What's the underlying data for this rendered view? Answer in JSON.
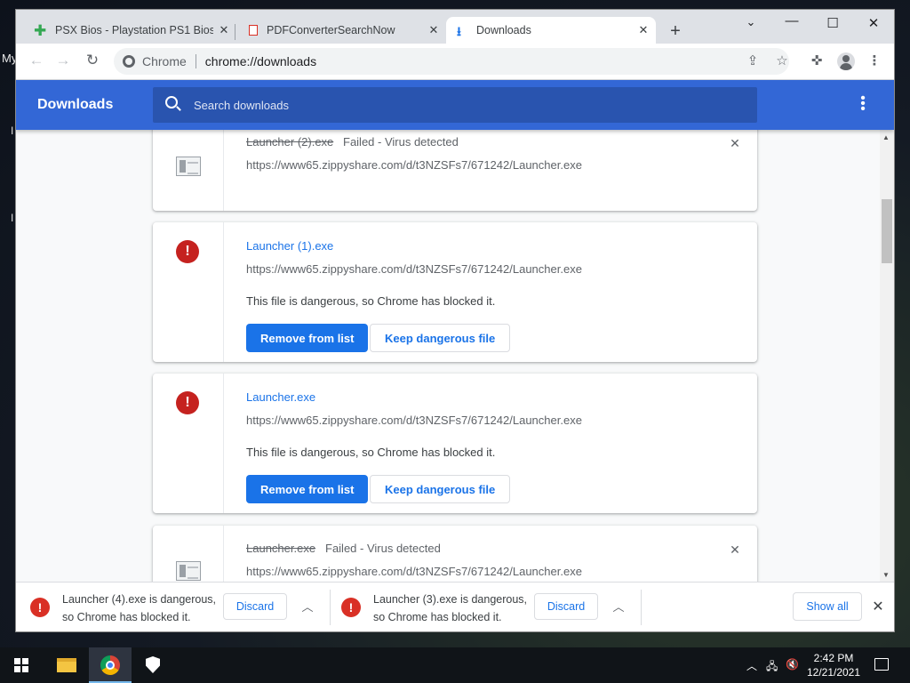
{
  "window": {
    "tabs": [
      {
        "title": "PSX Bios - Playstation PS1 Bios (",
        "icon": "puzzle-plus-icon"
      },
      {
        "title": "PDFConverterSearchNow",
        "icon": "pdf-icon"
      },
      {
        "title": "Downloads",
        "icon": "download-icon"
      }
    ],
    "close_glyph": "✕",
    "new_tab_glyph": "+"
  },
  "toolbar": {
    "site_label": "Chrome",
    "url": "chrome://downloads"
  },
  "downloads": {
    "title": "Downloads",
    "search_placeholder": "Search downloads",
    "items": [
      {
        "name": "Launcher (2).exe",
        "status": "Failed - Virus detected",
        "url": "https://www65.zippyshare.com/d/t3NZSFs7/671242/Launcher.exe"
      },
      {
        "name": "Launcher (1).exe",
        "url": "https://www65.zippyshare.com/d/t3NZSFs7/671242/Launcher.exe",
        "message": "This file is dangerous, so Chrome has blocked it.",
        "primary_action": "Remove from list",
        "secondary_action": "Keep dangerous file"
      },
      {
        "name": "Launcher.exe",
        "url": "https://www65.zippyshare.com/d/t3NZSFs7/671242/Launcher.exe",
        "message": "This file is dangerous, so Chrome has blocked it.",
        "primary_action": "Remove from list",
        "secondary_action": "Keep dangerous file"
      },
      {
        "name": "Launcher.exe",
        "status": "Failed - Virus detected",
        "url": "https://www65.zippyshare.com/d/t3NZSFs7/671242/Launcher.exe"
      }
    ]
  },
  "shelf": {
    "items": [
      {
        "line1": "Launcher (4).exe is dangerous,",
        "line2": "so Chrome has blocked it.",
        "action": "Discard"
      },
      {
        "line1": "Launcher (3).exe is dangerous,",
        "line2": "so Chrome has blocked it.",
        "action": "Discard"
      }
    ],
    "show_all": "Show all"
  },
  "desktop": {
    "label": "My"
  },
  "taskbar": {
    "time": "2:42 PM",
    "date": "12/21/2021"
  },
  "colors": {
    "header_blue": "#3367d6",
    "link_blue": "#1a73e8",
    "danger_red": "#c5221f"
  }
}
